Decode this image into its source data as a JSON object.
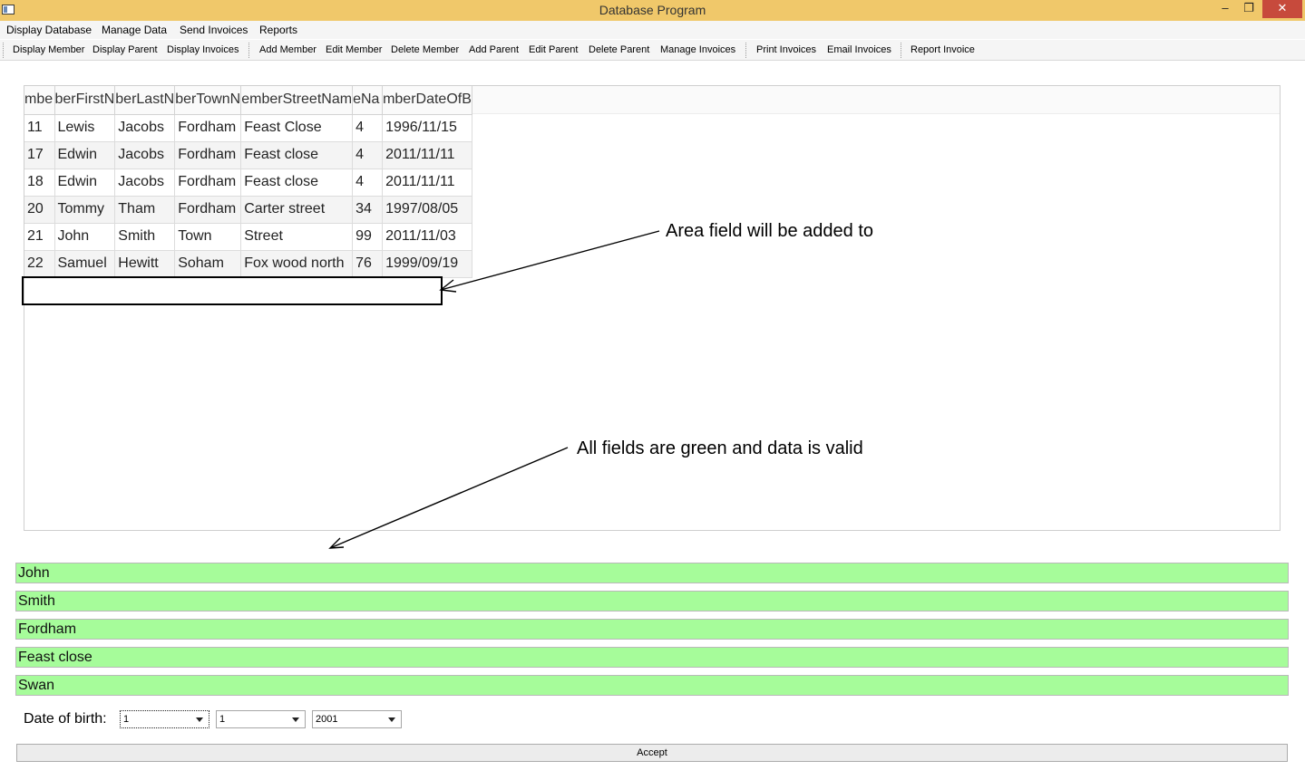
{
  "window": {
    "title": "Database Program",
    "minimize": "–",
    "maximize": "❐",
    "close": "✕"
  },
  "menu": [
    "Display Database",
    "Manage Data",
    "Send Invoices",
    "Reports"
  ],
  "toolbar": [
    "Display Member",
    "Display Parent",
    "Display Invoices",
    "Add Member",
    "Edit Member",
    "Delete Member",
    "Add Parent",
    "Edit Parent",
    "Delete Parent",
    "Manage Invoices",
    "Print Invoices",
    "Email Invoices",
    "Report Invoice"
  ],
  "table": {
    "headers": [
      "mbe",
      "berFirstN",
      "berLastN",
      "berTownN",
      "emberStreetNam",
      "eNa",
      "mberDateOfB"
    ],
    "rows": [
      [
        "11",
        "Lewis",
        "Jacobs",
        "Fordham",
        "Feast Close",
        "4",
        "1996/11/15"
      ],
      [
        "17",
        "Edwin",
        "Jacobs",
        "Fordham",
        "Feast close",
        "4",
        "2011/11/11"
      ],
      [
        "18",
        "Edwin",
        "Jacobs",
        "Fordham",
        "Feast close",
        "4",
        "2011/11/11"
      ],
      [
        "20",
        "Tommy",
        "Tham",
        "Fordham",
        "Carter street",
        "34",
        "1997/08/05"
      ],
      [
        "21",
        "John",
        "Smith",
        "Town",
        "Street",
        "99",
        "2011/11/03"
      ],
      [
        "22",
        "Samuel",
        "Hewitt",
        "Soham",
        "Fox wood north",
        "76",
        "1999/09/19"
      ]
    ]
  },
  "annotations": {
    "area": "Area field will be added to",
    "valid": "All fields are green and data is valid"
  },
  "fields": [
    "John",
    "Smith",
    "Fordham",
    "Feast close",
    "Swan"
  ],
  "dob": {
    "label": "Date of birth:",
    "day": "1",
    "month": "1",
    "year": "2001"
  },
  "accept_label": "Accept",
  "colors": {
    "titlebar": "#f0c86a",
    "valid_field": "#a6fc9a",
    "close_button": "#c74a3c"
  }
}
